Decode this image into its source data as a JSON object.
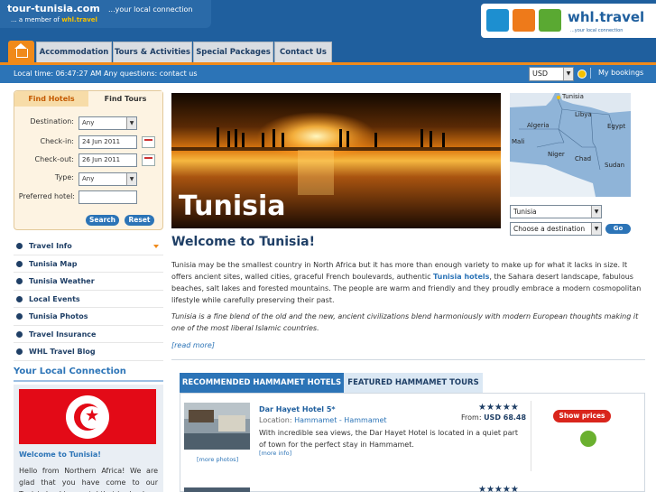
{
  "header": {
    "site": "tour-tunisia.com",
    "tagline": "...your local connection",
    "member_prefix": "... a member of",
    "member_brand": "whl.travel",
    "whl_name": "whl.travel",
    "whl_sub": "...your local connection"
  },
  "nav": {
    "tabs": [
      "Accommodation",
      "Tours & Activities",
      "Special Packages",
      "Contact Us"
    ]
  },
  "bar": {
    "local_time": "Local time: 06:47:27 AM",
    "question": "Any questions: contact us",
    "currency": "USD",
    "my_bookings": "My bookings"
  },
  "search": {
    "tab_hotels": "Find Hotels",
    "tab_tours": "Find Tours",
    "destination_label": "Destination:",
    "destination_value": "Any",
    "checkin_label": "Check-in:",
    "checkin_value": "24 Jun 2011",
    "checkout_label": "Check-out:",
    "checkout_value": "26 Jun 2011",
    "type_label": "Type:",
    "type_value": "Any",
    "preferred_label": "Preferred hotel:",
    "search_btn": "Search",
    "reset_btn": "Reset"
  },
  "menu": [
    "Travel Info",
    "Tunisia Map",
    "Tunisia Weather",
    "Local Events",
    "Tunisia Photos",
    "Travel Insurance",
    "WHL Travel Blog"
  ],
  "ylc": {
    "title": "Your Local Connection",
    "welcome": "Welcome to Tunisia!",
    "text": "Hello from Northern Africa! We are glad that you have come to our Tunisia booking portal that is chock"
  },
  "hero": {
    "title": "Tunisia"
  },
  "map": {
    "labels": [
      "Tunisia",
      "Libya",
      "Algeria",
      "Egypt",
      "Mali",
      "Niger",
      "Chad",
      "Sudan"
    ]
  },
  "dest": {
    "country": "Tunisia",
    "choose": "Choose a destination",
    "go": "Go"
  },
  "content": {
    "welcome": "Welcome to Tunisia!",
    "para1_a": "Tunisia may be the smallest country in North Africa but it has more than enough variety to make up for what it lacks in size. It offers ancient sites, walled cities, graceful French boulevards, authentic ",
    "para1_link": "Tunisia hotels",
    "para1_b": ", the Sahara desert landscape, fabulous beaches, salt lakes and forested mountains. The people are warm and friendly and they proudly embrace a modern cosmopolitan lifestyle while carefully preserving their past.",
    "para2": "Tunisia is a fine blend of the old and the new, ancient civilizations blend harmoniously with modern European thoughts making it one of the most liberal Islamic countries.",
    "read_more": "[read more]"
  },
  "hotels": {
    "tab_recommended": "RECOMMENDED HAMMAMET HOTELS",
    "tab_tours": "FEATURED HAMMAMET TOURS",
    "name": "Dar Hayet Hotel 5*",
    "location_label": "Location:",
    "location_value": "Hammamet - Hammamet",
    "description": "With incredible sea views, the Dar Hayet Hotel is located in a quiet part of town for the perfect stay in Hammamet.",
    "more_info": "[more info]",
    "more_photos": "[more photos]",
    "stars": "★★★★★",
    "price_from": "From:",
    "price_value": "USD 68.48",
    "show_prices": "Show prices"
  },
  "colors": {
    "brand_blue": "#1f5f9e",
    "accent_orange": "#f08a1a",
    "price_red": "#d9251c"
  }
}
